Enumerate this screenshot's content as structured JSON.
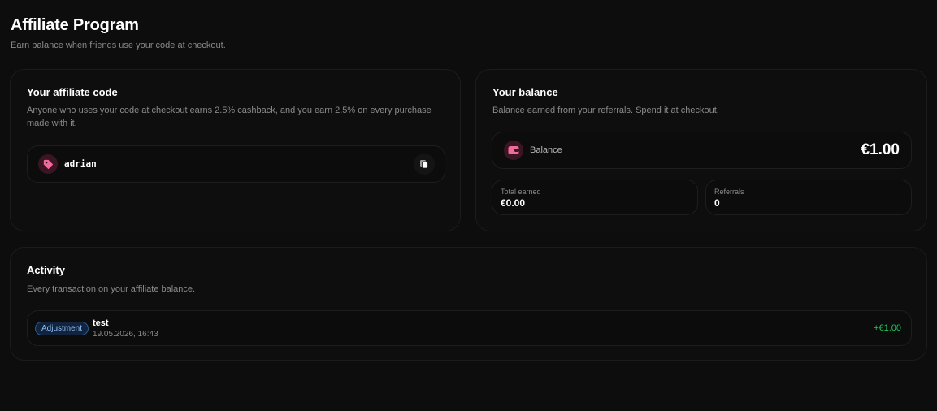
{
  "page": {
    "title": "Affiliate Program",
    "subtitle": "Earn balance when friends use your code at checkout."
  },
  "affiliate_code_card": {
    "title": "Your affiliate code",
    "description_line1": "Anyone who uses your code at checkout earns 2.5% cashback, and you earn 2.5% on every purchase",
    "description_line2": "made with it.",
    "code": "adrian",
    "code_icon": "tag-icon",
    "copy_icon": "copy-icon"
  },
  "balance_card": {
    "title": "Your balance",
    "description": "Balance earned from your referrals. Spend it at checkout.",
    "balance_label": "Balance",
    "balance_value": "€1.00",
    "balance_icon": "wallet-icon",
    "total_earned_label": "Total earned",
    "total_earned_value": "€0.00",
    "referrals_label": "Referrals",
    "referrals_value": "0"
  },
  "activity_card": {
    "title": "Activity",
    "description": "Every transaction on your affiliate balance.",
    "transactions": [
      {
        "type": "Adjustment",
        "title": "test",
        "date": "19.05.2026, 16:43",
        "amount": "+€1.00"
      }
    ]
  },
  "colors": {
    "background": "#0d0d0d",
    "accent_pink": "#f06a9e",
    "positive_green": "#22c55e",
    "badge_blue": "#8fbff5"
  }
}
